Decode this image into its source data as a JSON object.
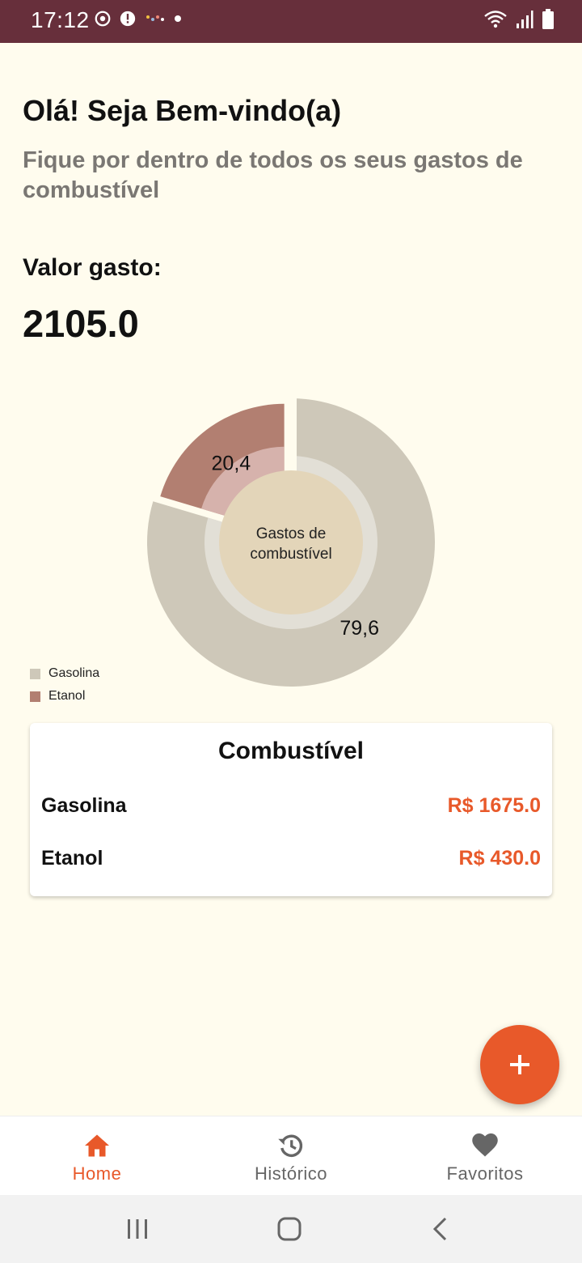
{
  "status_bar": {
    "time": "17:12",
    "background": "#672f3b"
  },
  "greeting": {
    "title": "Olá! Seja Bem-vindo(a)",
    "subtitle": "Fique por dentro de todos os seus gastos de combustível"
  },
  "summary": {
    "label": "Valor gasto:",
    "value": "2105.0"
  },
  "chart_data": {
    "type": "pie",
    "center_label": "Gastos de combustível",
    "slices": [
      {
        "name": "Gasolina",
        "value": 79.6,
        "label": "79,6",
        "color": "#cec8b9"
      },
      {
        "name": "Etanol",
        "value": 20.4,
        "label": "20,4",
        "color": "#b27f71"
      }
    ],
    "legend": [
      "Gasolina",
      "Etanol"
    ],
    "legend_placement": "bottom-left"
  },
  "card": {
    "title": "Combustível",
    "rows": [
      {
        "name": "Gasolina",
        "amount": "R$ 1675.0"
      },
      {
        "name": "Etanol",
        "amount": "R$ 430.0"
      }
    ]
  },
  "fab": {
    "icon": "plus-icon"
  },
  "bottom_nav": {
    "items": [
      {
        "label": "Home",
        "icon": "home-icon",
        "active": true
      },
      {
        "label": "Histórico",
        "icon": "history-icon",
        "active": false
      },
      {
        "label": "Favoritos",
        "icon": "heart-icon",
        "active": false
      }
    ]
  },
  "colors": {
    "accent": "#e8592a",
    "background": "#fffcee",
    "inactive": "#666666"
  }
}
